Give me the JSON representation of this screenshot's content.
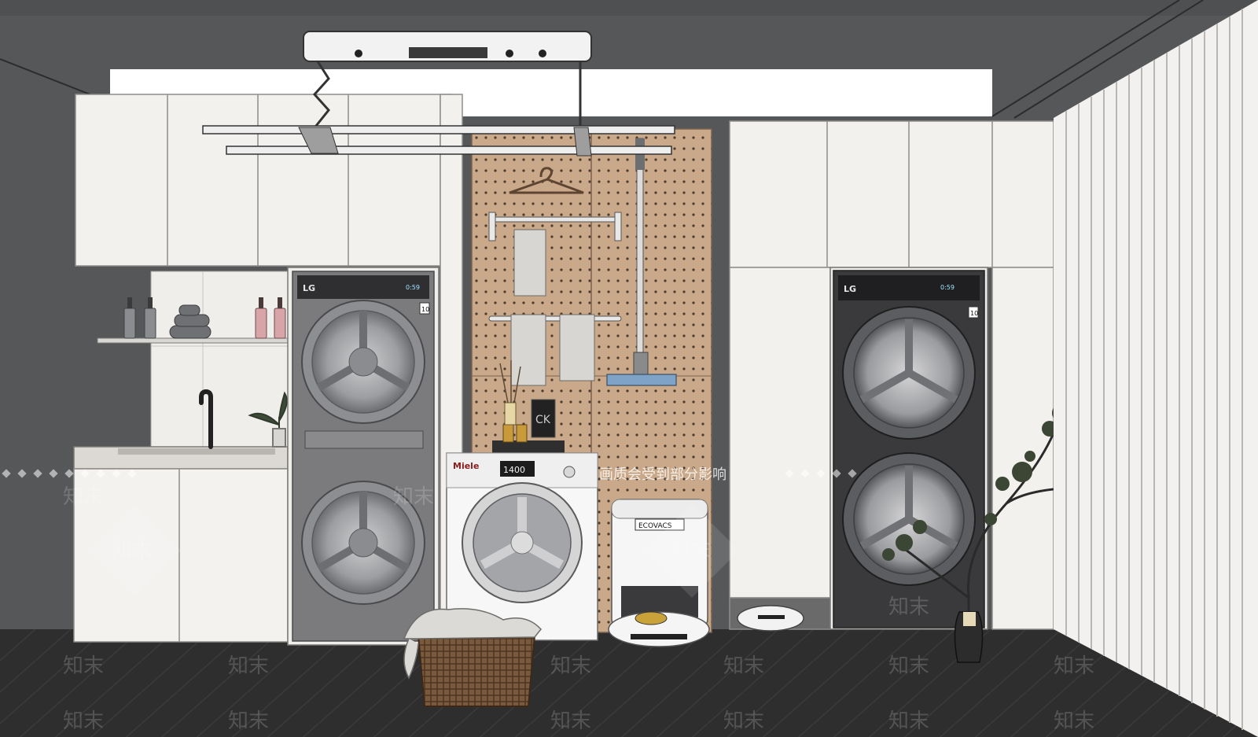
{
  "brands": {
    "left_stack": "LG",
    "right_stack": "LG",
    "washer": "Miele",
    "washer_display": "1400",
    "robot_station": "ECOVACS",
    "washer_badge": "10",
    "right_badge": "10",
    "stack_display": "0:59",
    "frame_logo": "CK"
  },
  "watermark": {
    "banner": "画质会受到部分影响",
    "logo_text": "知末"
  },
  "colors": {
    "wall": "#555759",
    "cabinet": "#f3f1ee",
    "pegboard": "#c9a989",
    "floor": "#2f2e2f",
    "machine_grey": "#7b7b7d",
    "machine_dark": "#3a3a3c"
  }
}
